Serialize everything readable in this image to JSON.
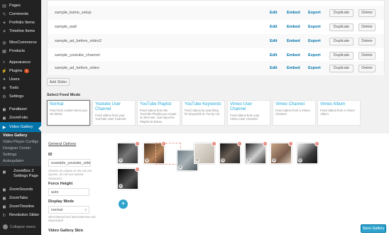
{
  "sidebar": {
    "items": [
      {
        "label": "Pages",
        "icon": "pages-icon",
        "glyph": "▤"
      },
      {
        "label": "Comments",
        "icon": "comments-icon",
        "glyph": "✎"
      },
      {
        "label": "Portfolio Items",
        "icon": "pin-icon",
        "glyph": "✦"
      },
      {
        "label": "Timeline Items",
        "icon": "pin-icon",
        "glyph": "✦"
      },
      {
        "label": "WooCommerce",
        "icon": "woocommerce-icon",
        "glyph": "◍"
      },
      {
        "label": "Products",
        "icon": "products-icon",
        "glyph": "▦"
      },
      {
        "label": "Appearance",
        "icon": "appearance-icon",
        "glyph": "◐"
      },
      {
        "label": "Plugins",
        "icon": "plugins-icon",
        "glyph": "⚡",
        "badge": "1"
      },
      {
        "label": "Users",
        "icon": "users-icon",
        "glyph": "●"
      },
      {
        "label": "Tools",
        "icon": "tools-icon",
        "glyph": "✚"
      },
      {
        "label": "Settings",
        "icon": "settings-icon",
        "glyph": "⚙"
      },
      {
        "label": "Parallaxer",
        "icon": "parallaxer-icon",
        "glyph": "◼"
      },
      {
        "label": "ZoomFolio",
        "icon": "zoomfolio-icon",
        "glyph": "◼"
      },
      {
        "label": "Video Gallery",
        "icon": "video-gallery-icon",
        "glyph": "▶",
        "active": true
      }
    ],
    "submenu": [
      "Video Gallery",
      "Video Player Configs",
      "Designer Center",
      "Settings",
      "Autoupdater"
    ],
    "zoombox": "ZoomBox 2 Settings Page",
    "lower": [
      {
        "label": "ZoomSounds",
        "glyph": "◼"
      },
      {
        "label": "ZoomTabs",
        "glyph": "◼"
      },
      {
        "label": "ZoomTimeline",
        "glyph": "◼"
      },
      {
        "label": "Revolution Slider",
        "glyph": "↻"
      }
    ],
    "collapse": "Collapse menu"
  },
  "sliders": {
    "rows": [
      {
        "name": "sample_balne_setup"
      },
      {
        "name": "sample_wall"
      },
      {
        "name": "sample_ad_before_video2"
      },
      {
        "name": "sample_youtube_channel"
      },
      {
        "name": "sample_ad_before_video"
      }
    ],
    "edit": "Edit",
    "embed": "Embed",
    "export": "Export",
    "duplicate": "Duplicate",
    "delete": "Delete",
    "add_slider": "Add Slider"
  },
  "feed": {
    "title": "Select Feed Mode",
    "modes": [
      {
        "title": "Normal",
        "desc": "Feed from custom items you set below.",
        "selected": true
      },
      {
        "title": "Youtube User Channel",
        "desc": "Feed videos from your YouTube User Channel."
      },
      {
        "title": "YouTube Playlist",
        "desc": "Feed videos from the YouTube Playlist you create on their site. Just input the Playlist ID below."
      },
      {
        "title": "YouTube Keywords",
        "desc": "Feed videos by searching for keywords ie. Funny cat"
      },
      {
        "title": "Vimeo User Channel",
        "desc": "Feed videos from your Vimeo User Channel."
      },
      {
        "title": "Vimeo Channel",
        "desc": "Feed videos from a Vimeo Channel."
      },
      {
        "title": "Vimeo Album",
        "desc": "Feed videos from a Vimeo Album."
      }
    ]
  },
  "options": {
    "general_title": "General Options",
    "id_label": "ID",
    "id_value": "example_youtube_vide",
    "id_help": "Choose an unique id. Do not use spaces, do not use special characters.",
    "force_height_label": "Force Height",
    "force_height_value": "auto",
    "display_mode_label": "Display Mode",
    "display_mode_value": "normal",
    "display_mode_help": "alternatewall and alternatemenu are deprecated",
    "skin_label": "Video Gallery Skin"
  },
  "thumbs": {
    "remove_glyph": "×",
    "settings_glyph": "⚙",
    "add_glyph": "+"
  },
  "save_label": "Save Gallery"
}
